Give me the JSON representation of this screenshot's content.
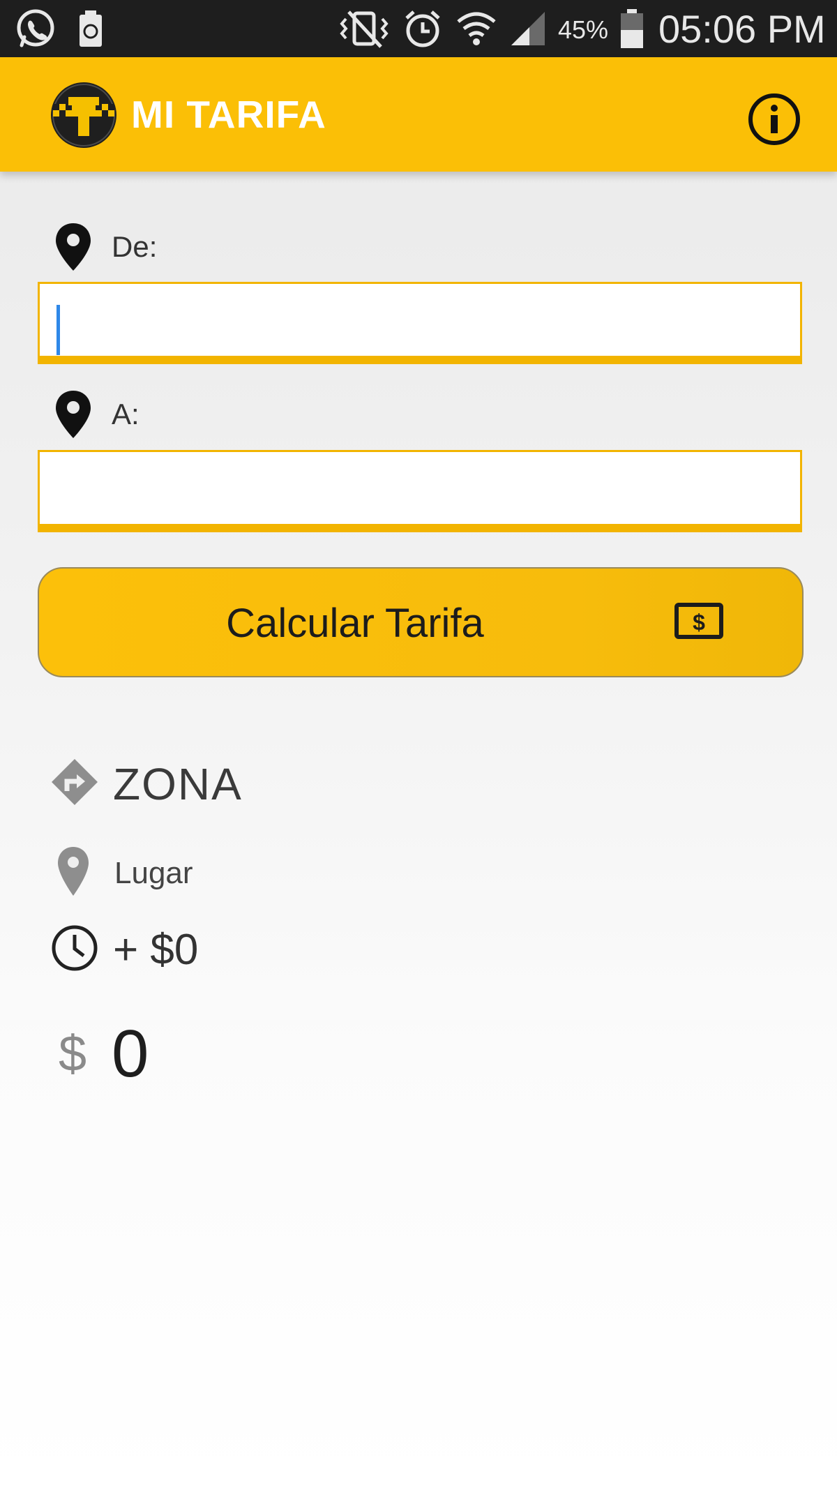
{
  "status_bar": {
    "battery_percent": "45%",
    "time": "05:06 PM",
    "icons": [
      "whatsapp-icon",
      "battery-saver-icon",
      "vibrate-mute-icon",
      "alarm-icon",
      "wifi-icon",
      "signal-icon",
      "battery-icon"
    ]
  },
  "app_bar": {
    "title": "MI TARIFA",
    "logo_icon": "taxi-logo-icon",
    "info_icon": "info-icon",
    "color": "#fbbf06"
  },
  "form": {
    "from_label": "De:",
    "from_value": "",
    "to_label": "A:",
    "to_value": "",
    "pin_icon": "map-pin-icon"
  },
  "calculate_button": {
    "label": "Calcular Tarifa",
    "icon": "money-bill-icon"
  },
  "result": {
    "zone": "ZONA",
    "place": "Lugar",
    "extra_charge": "+ $0",
    "currency_symbol": "$",
    "total": "0"
  }
}
